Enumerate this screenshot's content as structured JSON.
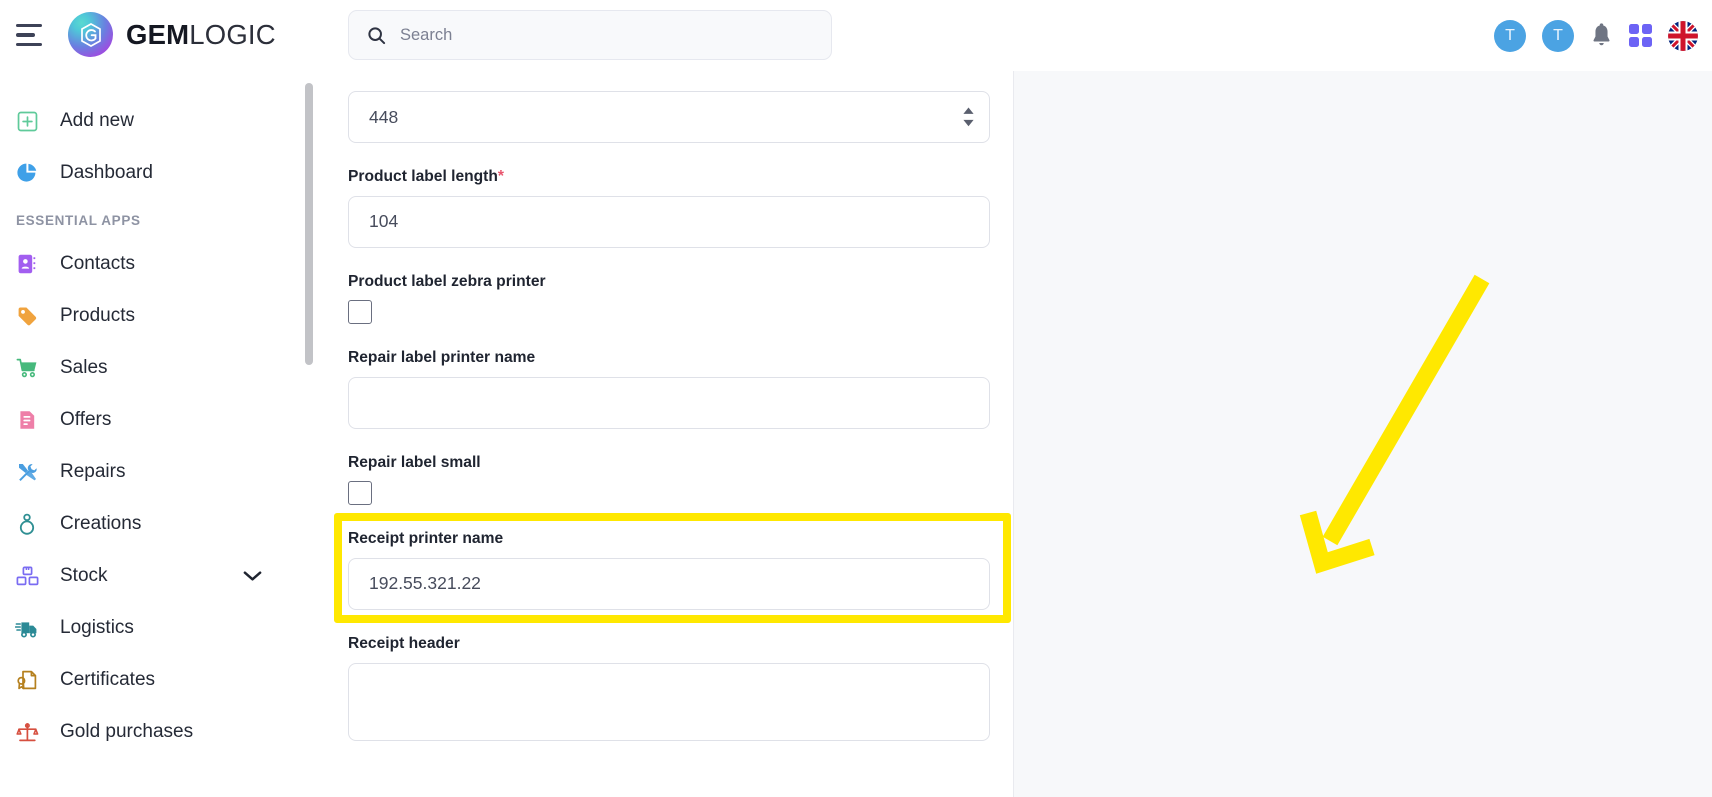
{
  "topbar": {
    "menu_icon": "hamburger-menu-icon",
    "brand_bold": "GEM",
    "brand_light": "LOGIC",
    "logo_icon": "gemlogic-logo-icon",
    "search": {
      "icon": "search-icon",
      "placeholder": "Search",
      "value": ""
    },
    "avatars": [
      {
        "initial": "T",
        "color": "#4ba3e3"
      },
      {
        "initial": "T",
        "color": "#4ba3e3"
      }
    ],
    "notification_icon": "bell-icon",
    "apps_icon": "grid-apps-icon",
    "language_icon": "uk-flag-icon"
  },
  "sidebar": {
    "section_label": "ESSENTIAL APPS",
    "items": [
      {
        "label": "Add new",
        "icon": "plus-square-icon",
        "color": "#5fca9a",
        "expandable": false
      },
      {
        "label": "Dashboard",
        "icon": "pie-chart-icon",
        "color": "#3fa0e8",
        "expandable": false
      },
      {
        "label": "Contacts",
        "icon": "contact-book-icon",
        "color": "#a25ef0",
        "expandable": false
      },
      {
        "label": "Products",
        "icon": "tag-icon",
        "color": "#f0a33e",
        "expandable": false
      },
      {
        "label": "Sales",
        "icon": "shopping-cart-icon",
        "color": "#46b97c",
        "expandable": false
      },
      {
        "label": "Offers",
        "icon": "document-icon",
        "color": "#ee7fa8",
        "expandable": false
      },
      {
        "label": "Repairs",
        "icon": "tools-icon",
        "color": "#4a9ee0",
        "expandable": false
      },
      {
        "label": "Creations",
        "icon": "ring-icon",
        "color": "#2f8f93",
        "expandable": false
      },
      {
        "label": "Stock",
        "icon": "boxes-icon",
        "color": "#7a6cf2",
        "expandable": true
      },
      {
        "label": "Logistics",
        "icon": "delivery-truck-icon",
        "color": "#2b8a96",
        "expandable": false
      },
      {
        "label": "Certificates",
        "icon": "certificate-icon",
        "color": "#b5801e",
        "expandable": false
      },
      {
        "label": "Gold purchases",
        "icon": "scales-icon",
        "color": "#d64f3f",
        "expandable": false
      }
    ],
    "expand_icon": "chevron-down-icon"
  },
  "form": {
    "fields": [
      {
        "type": "number",
        "label": null,
        "value": "448",
        "required": false,
        "stepper_icon": "spinner-arrows-icon"
      },
      {
        "type": "number",
        "label": "Product label length",
        "required": true,
        "required_mark": "*",
        "value": "104"
      },
      {
        "type": "checkbox",
        "label": "Product label zebra printer",
        "checked": false
      },
      {
        "type": "text",
        "label": "Repair label printer name",
        "value": ""
      },
      {
        "type": "checkbox",
        "label": "Repair label small",
        "checked": false
      },
      {
        "type": "text",
        "label": "Receipt printer name",
        "value": "192.55.321.22",
        "highlighted": true
      },
      {
        "type": "textarea",
        "label": "Receipt header",
        "value": ""
      }
    ]
  },
  "annotation": {
    "highlight_color": "#ffe800",
    "arrow_color": "#ffe800",
    "target_field": "Receipt printer name"
  },
  "colors": {
    "page_background": "#f7f8fa",
    "panel_background": "#ffffff",
    "text_primary": "#1f2430",
    "text_muted": "#7c8092",
    "border": "#dfe1e8",
    "accent_required": "#e8556d",
    "avatar_blue": "#4ba3e3",
    "apps_purple": "#6c63f5"
  }
}
